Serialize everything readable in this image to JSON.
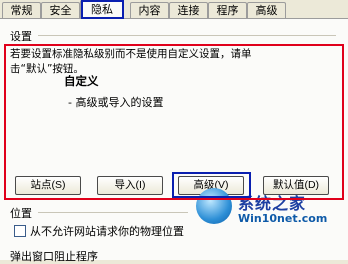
{
  "tabs": [
    "常规",
    "安全",
    "隐私",
    "内容",
    "连接",
    "程序",
    "高级"
  ],
  "settings": {
    "group_title": "设置",
    "description_line1": "若要设置标准隐私级别而不是使用自定义设置，请单",
    "description_line2": "击“默认”按钮。",
    "level": "自定义",
    "detail": "- 高级或导入的设置",
    "buttons": {
      "sites": "站点(S)",
      "import": "导入(I)",
      "advanced": "高级(V)",
      "default": "默认值(D)"
    }
  },
  "location": {
    "group_title": "位置",
    "checkbox_label": "从不允许网站请求你的物理位置"
  },
  "popup": {
    "group_title": "弹出窗口阻止程序"
  },
  "watermark": {
    "title": "系统之家",
    "url": "Win10net.com"
  },
  "colors": {
    "highlight_red": "#e0001b",
    "highlight_blue": "#0a1fb0"
  }
}
